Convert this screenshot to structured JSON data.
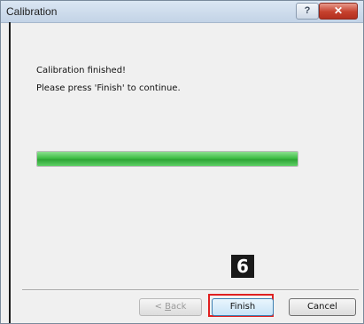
{
  "window": {
    "title": "Calibration",
    "help_label": "?",
    "close_label": "✕"
  },
  "content": {
    "line1": "Calibration finished!",
    "line2": "Please press 'Finish' to continue."
  },
  "progress": {
    "fraction": 1.0,
    "color": "#3fbe46"
  },
  "annotation": {
    "step_number": "6"
  },
  "buttons": {
    "back_prefix": "< ",
    "back_accel": "B",
    "back_rest": "ack",
    "finish_label": "Finish",
    "cancel_label": "Cancel"
  }
}
